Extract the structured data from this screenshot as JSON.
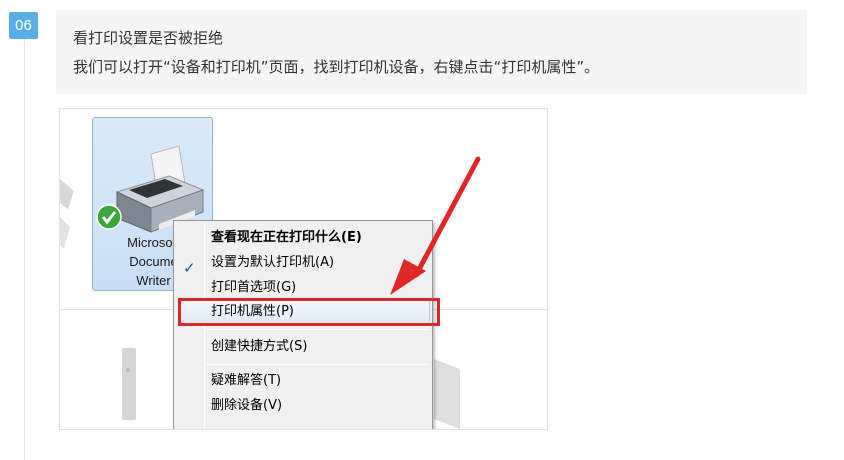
{
  "step": {
    "number": "06"
  },
  "note": {
    "title": "看打印设置是否被拒绝",
    "text": "我们可以打开“设备和打印机”页面，找到打印机设备，右键点击“打印机属性”。"
  },
  "screenshot": {
    "device": {
      "name_lines": [
        "Microsoft",
        "Docume",
        "Writer"
      ],
      "status_icon": "green-check-icon"
    },
    "context_menu": {
      "items": [
        {
          "label": "查看现在正在打印什么(E)",
          "bold": true
        },
        {
          "label": "设置为默认打印机(A)",
          "checked": true
        },
        {
          "label": "打印首选项(G)"
        },
        {
          "label": "打印机属性(P)",
          "highlighted": true
        },
        {
          "label": "创建快捷方式(S)"
        },
        {
          "label": "疑难解答(T)"
        },
        {
          "label": "删除设备(V)"
        }
      ]
    },
    "annotation": {
      "color": "#e02727"
    }
  },
  "colors": {
    "badge": "#5aaee8",
    "note_background": "#f5f5f5",
    "text": "#333333"
  }
}
